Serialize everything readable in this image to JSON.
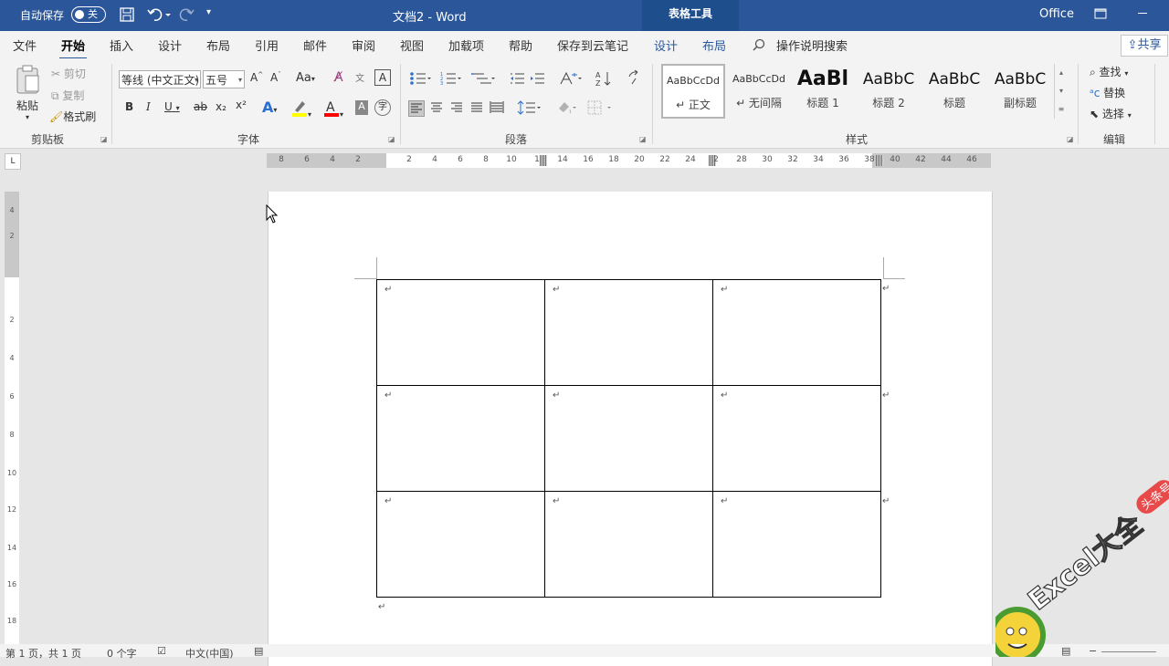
{
  "titlebar": {
    "autosave_label": "自动保存",
    "autosave_state": "关",
    "doc_title": "文档2 - Word",
    "context_tab": "表格工具",
    "account": "Office"
  },
  "menu": {
    "tabs": [
      "文件",
      "开始",
      "插入",
      "设计",
      "布局",
      "引用",
      "邮件",
      "审阅",
      "视图",
      "加载项",
      "帮助",
      "保存到云笔记",
      "设计",
      "布局"
    ],
    "search": "操作说明搜索",
    "share": "共享"
  },
  "ribbon": {
    "clipboard": {
      "paste": "粘贴",
      "cut": "剪切",
      "copy": "复制",
      "format_painter": "格式刷",
      "label": "剪贴板"
    },
    "font": {
      "font_name": "等线 (中文正文)",
      "font_size": "五号",
      "label": "字体",
      "bold": "B",
      "italic": "I",
      "underline": "U",
      "strike": "ab",
      "subscript": "x₂",
      "superscript": "x²",
      "aa": "Aa",
      "A": "A"
    },
    "paragraph": {
      "label": "段落"
    },
    "styles": {
      "label": "样式",
      "items": [
        {
          "preview": "AaBbCcDd",
          "name": "↵ 正文"
        },
        {
          "preview": "AaBbCcDd",
          "name": "↵ 无间隔"
        },
        {
          "preview": "AaBl",
          "name": "标题 1"
        },
        {
          "preview": "AaBbC",
          "name": "标题 2"
        },
        {
          "preview": "AaBbC",
          "name": "标题"
        },
        {
          "preview": "AaBbC",
          "name": "副标题"
        }
      ]
    },
    "editing": {
      "find": "查找",
      "replace": "替换",
      "select": "选择",
      "label": "编辑"
    }
  },
  "ruler": {
    "h_left": [
      "8",
      "6",
      "4",
      "2"
    ],
    "h_right": [
      "2",
      "4",
      "6",
      "8",
      "10",
      "1",
      "14",
      "16",
      "18",
      "20",
      "22",
      "24",
      "2",
      "28",
      "30",
      "32",
      "34",
      "36",
      "38",
      "40",
      "42",
      "44",
      "46"
    ],
    "v": [
      "4",
      "2",
      "",
      "2",
      "4",
      "6",
      "8",
      "10",
      "12",
      "14",
      "16",
      "18"
    ]
  },
  "document": {
    "table": {
      "rows": 3,
      "cols": 3,
      "cell_mark": "↵"
    },
    "trailing_mark": "↵"
  },
  "statusbar": {
    "page": "第 1 页，共 1 页",
    "words": "0 个字",
    "language": "中文(中国)"
  },
  "watermark": {
    "text": "Excel大全",
    "badge": "头条号"
  },
  "colors": {
    "brand": "#2b579a",
    "highlight": "#ffff00",
    "font_color": "#ff0000"
  }
}
